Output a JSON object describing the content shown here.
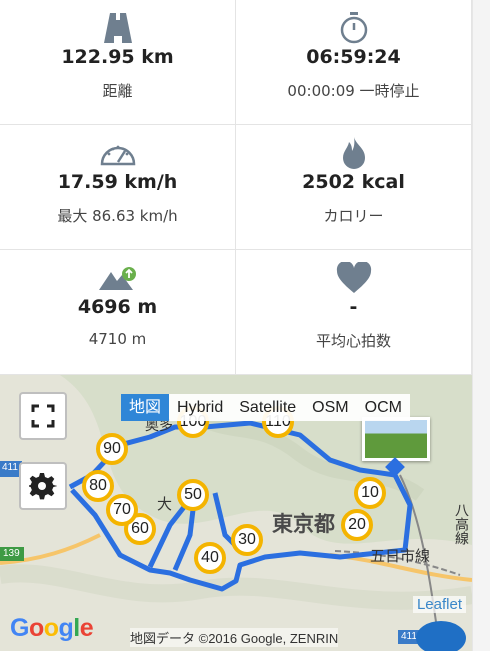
{
  "stats": [
    {
      "icon": "road-icon",
      "value": "122.95 km",
      "label": "距離"
    },
    {
      "icon": "stopwatch-icon",
      "value": "06:59:24",
      "label": "00:00:09 一時停止"
    },
    {
      "icon": "speedometer-icon",
      "value": "17.59 km/h",
      "label": "最大 86.63 km/h"
    },
    {
      "icon": "flame-icon",
      "value": "2502 kcal",
      "label": "カロリー"
    },
    {
      "icon": "elevation-icon",
      "value": "4696 m",
      "label": "4710 m"
    },
    {
      "icon": "heart-icon",
      "value": "-",
      "label": "平均心拍数"
    }
  ],
  "map": {
    "layers": [
      "地図",
      "Hybrid",
      "Satellite",
      "OSM",
      "OCM"
    ],
    "active_layer": "地図",
    "leaflet": "Leaflet",
    "attribution": "地図データ ©2016 Google, ZENRIN",
    "google_logo": "Google",
    "place_labels": [
      "東京都",
      "大",
      "五日市線",
      "八高線",
      "411",
      "139",
      "411",
      "奥多"
    ],
    "route_color": "#2b6fe0",
    "marker_color": "#f4b400",
    "km_markers": [
      "10",
      "20",
      "30",
      "40",
      "50",
      "60",
      "70",
      "80",
      "90",
      "100",
      "110"
    ]
  }
}
